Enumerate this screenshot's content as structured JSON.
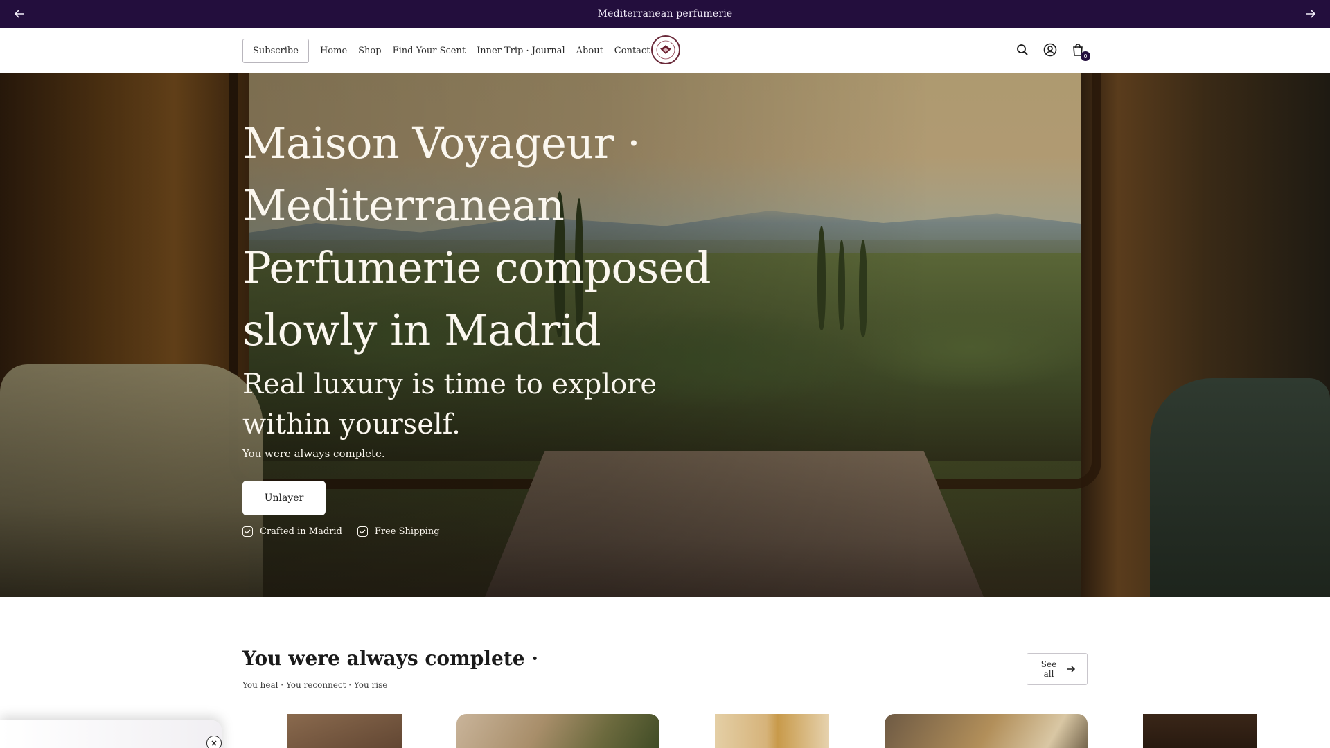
{
  "announcement": {
    "message": "Mediterranean perfumerie",
    "prev_icon": "arrow-left-icon",
    "next_icon": "arrow-right-icon"
  },
  "header": {
    "subscribe_label": "Subscribe",
    "nav": [
      {
        "label": "Home"
      },
      {
        "label": "Shop"
      },
      {
        "label": "Find Your Scent"
      },
      {
        "label": "Inner Trip · Journal"
      },
      {
        "label": "About"
      },
      {
        "label": "Contact"
      }
    ],
    "logo_icon": "maison-voyageur-logo-icon",
    "icons": [
      "search-icon",
      "account-icon",
      "cart-icon"
    ],
    "cart_count": "0",
    "accent_color": "#230e3d"
  },
  "hero": {
    "title": "Maison Voyageur · Mediterranean Perfumerie composed slowly in Madrid",
    "subtitle": "Real luxury is time to explore within yourself.",
    "tagline": "You were always complete.",
    "cta_label": "Unlayer",
    "badges": [
      {
        "label": "Crafted in Madrid",
        "icon": "checkbox-check-icon"
      },
      {
        "label": "Free Shipping",
        "icon": "checkbox-check-icon"
      }
    ]
  },
  "collection": {
    "title": "You were always complete ·",
    "subtitle": "You heal · You reconnect · You rise",
    "see_all_label": "See all",
    "see_all_icon": "arrow-right-icon",
    "cards": [
      "product-card-1",
      "product-card-2",
      "product-card-3",
      "product-card-4",
      "product-card-5"
    ]
  },
  "popup": {
    "close_icon": "close-circle-icon"
  }
}
